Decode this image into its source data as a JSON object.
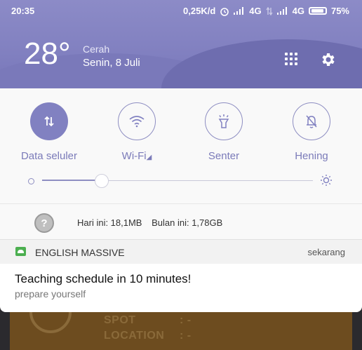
{
  "status_bar": {
    "time": "20:35",
    "network_speed": "0,25K/d",
    "network_type_1": "4G",
    "network_type_2": "4G",
    "battery": "75%"
  },
  "weather": {
    "temperature": "28°",
    "condition": "Cerah",
    "date": "Senin, 8 Juli"
  },
  "quick_settings": {
    "tiles": [
      {
        "label": "Data seluler",
        "icon": "data-transfer-icon",
        "active": true
      },
      {
        "label": "Wi-Fi",
        "icon": "wifi-icon",
        "active": false
      },
      {
        "label": "Senter",
        "icon": "flashlight-icon",
        "active": false
      },
      {
        "label": "Hening",
        "icon": "bell-off-icon",
        "active": false
      }
    ],
    "brightness_level": 0.22,
    "usage_today": "Hari ini: 18,1MB",
    "usage_month": "Bulan ini: 1,78GB"
  },
  "notification": {
    "app_name": "ENGLISH MASSIVE",
    "time": "sekarang",
    "title": "Teaching schedule in 10 minutes!",
    "text": "prepare yourself"
  },
  "background_app": {
    "line1": "SPOT",
    "line1_value": ": -",
    "line2": "LOCATION",
    "line2_value": ": -"
  },
  "colors": {
    "accent": "#8181c1",
    "header": "#8180c0",
    "background_card": "#6d4c1f"
  }
}
